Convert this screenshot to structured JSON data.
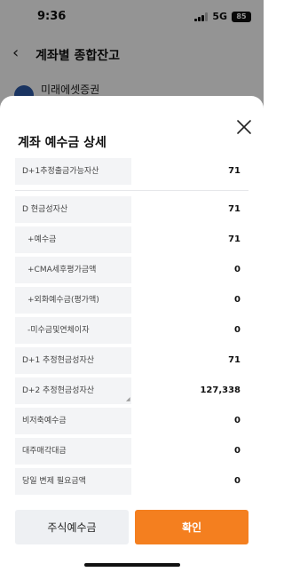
{
  "status_bar": {
    "time": "9:36",
    "network": "5G",
    "battery": "85"
  },
  "background": {
    "back_icon": "chevron-left-icon",
    "title": "계좌별 종합잔고",
    "broker_name": "미래에셋증권"
  },
  "sheet": {
    "title": "계좌 예수금 상세",
    "close_icon": "close-icon",
    "rows": [
      {
        "label": "D+1추정출금가능자산",
        "value": "71"
      },
      {
        "label": "D 현금성자산",
        "value": "71"
      },
      {
        "label": "+예수금",
        "value": "71"
      },
      {
        "label": "+CMA세후평가금액",
        "value": "0"
      },
      {
        "label": "+외화예수금(평가액)",
        "value": "0"
      },
      {
        "label": "-미수금및연체이자",
        "value": "0"
      },
      {
        "label": "D+1 추정현금성자산",
        "value": "71"
      },
      {
        "label": "D+2 추정현금성자산",
        "value": "127,338"
      },
      {
        "label": "비저축예수금",
        "value": "0"
      },
      {
        "label": "대주매각대금",
        "value": "0"
      },
      {
        "label": "당일 변제 필요금액",
        "value": "0"
      }
    ],
    "buttons": {
      "secondary": "주식예수금",
      "primary": "확인"
    }
  },
  "colors": {
    "accent": "#f47f1f",
    "label_bg": "#f3f4f6",
    "secondary_bg": "#eef0f3"
  }
}
